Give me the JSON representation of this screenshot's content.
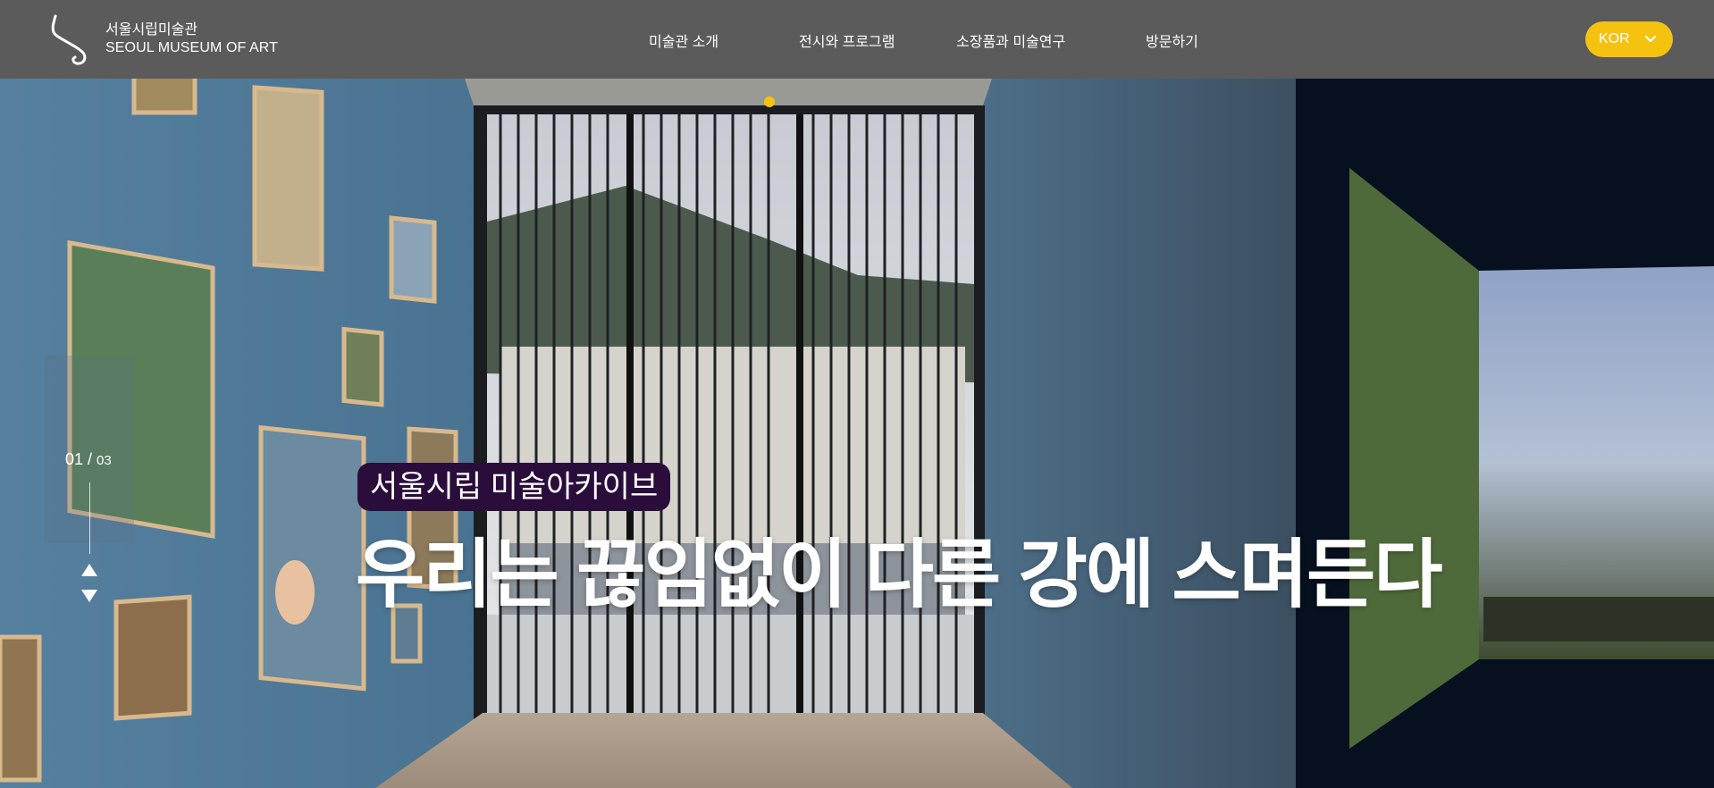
{
  "header": {
    "logo_icon": "s-logo-icon",
    "logo_kr": "서울시립미술관",
    "logo_en": "SEOUL MUSEUM OF ART",
    "nav": [
      {
        "label": "미술관 소개"
      },
      {
        "label": "전시와 프로그램"
      },
      {
        "label": "소장품과 미술연구"
      },
      {
        "label": "방문하기"
      }
    ],
    "language": {
      "label": "KOR",
      "icon": "chevron-down-icon"
    }
  },
  "hero": {
    "tag": "서울시립 미술아카이브",
    "headline": "우리는 끊임없이 다른 강에 스며든다",
    "slide_current": "01",
    "slide_separator": " / ",
    "slide_total": "03",
    "up_icon": "triangle-up-icon",
    "down_icon": "triangle-down-icon"
  },
  "colors": {
    "header_bg": "#5b5b5b",
    "accent": "#f5c20f",
    "tag_bg": "#2b0d3c"
  }
}
